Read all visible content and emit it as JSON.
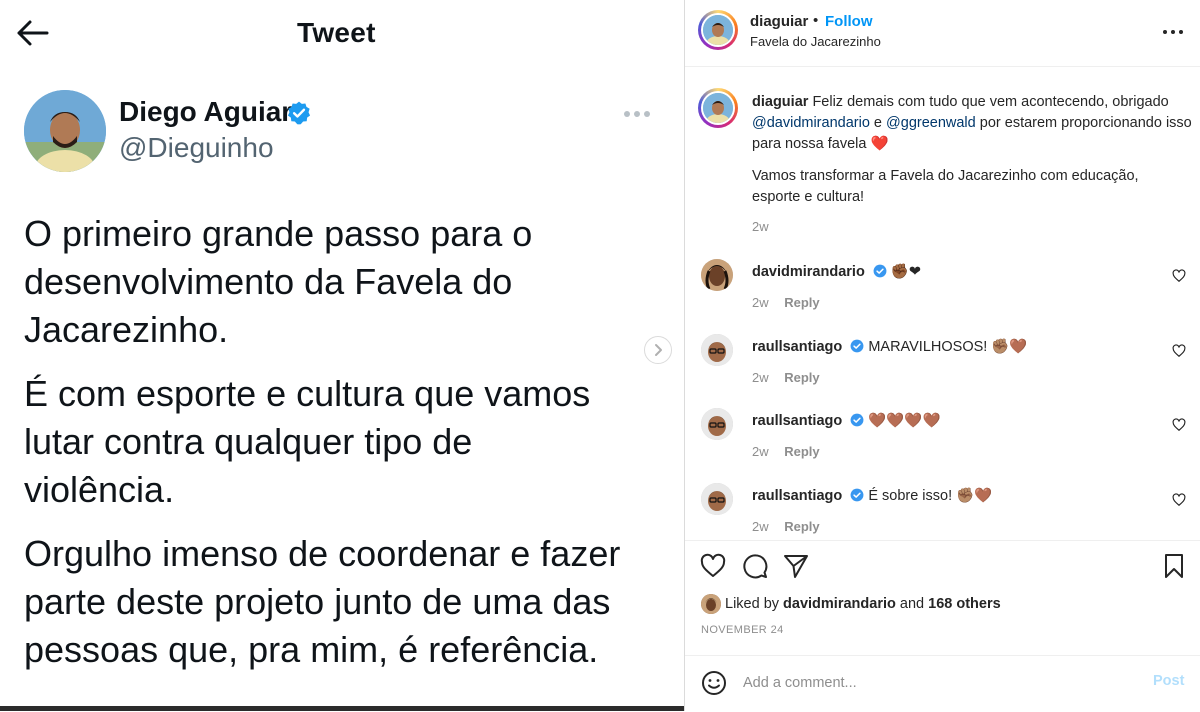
{
  "tweet": {
    "header_title": "Tweet",
    "author_name": "Diego Aguiar",
    "author_handle": "@Dieguinho",
    "paragraphs": [
      "O primeiro grande passo para  o\ndesenvolvimento da Favela do\nJacarezinho.",
      "É com esporte e cultura que vamos\nlutar contra qualquer tipo de\nviolência.",
      "Orgulho imenso de coordenar e fazer\nparte deste projeto junto de uma das\npessoas que, pra mim, é referência."
    ],
    "icons": {
      "back": "arrow-left-icon",
      "verified": "verified-badge-icon",
      "more": "more-horizontal-icon",
      "next": "chevron-right-icon"
    },
    "colors": {
      "verified": "#1d9bf0",
      "text": "#0f1419",
      "secondary": "#536471"
    }
  },
  "instagram": {
    "header": {
      "username": "diaguiar",
      "separator": "•",
      "follow_label": "Follow",
      "location": "Favela do Jacarezinho"
    },
    "caption": {
      "username": "diaguiar",
      "text_before": "Feliz demais com tudo que vem acontecendo, obrigado",
      "mention1": "@davidmirandario",
      "connector": "e",
      "mention2": "@ggreenwald",
      "text_after": "por estarem proporcionando isso para nossa favela ❤️",
      "paragraph2": "Vamos transformar a Favela do Jacarezinho com educação, esporte e cultura!",
      "time": "2w"
    },
    "comments": [
      {
        "username": "davidmirandario",
        "verified": true,
        "text": "✊🏾❤",
        "time": "2w",
        "reply_label": "Reply"
      },
      {
        "username": "raullsantiago",
        "verified": true,
        "text": "MARAVILHOSOS! ✊🏽🤎",
        "time": "2w",
        "reply_label": "Reply"
      },
      {
        "username": "raullsantiago",
        "verified": true,
        "text": "🤎🤎🤎🤎",
        "time": "2w",
        "reply_label": "Reply"
      },
      {
        "username": "raullsantiago",
        "verified": true,
        "text": "É sobre isso! ✊🏽🤎",
        "time": "2w",
        "reply_label": "Reply"
      }
    ],
    "likes": {
      "prefix": "Liked by",
      "user": "davidmirandario",
      "connector": "and",
      "others": "168 others"
    },
    "date": "NOVEMBER 24",
    "comment_box": {
      "placeholder": "Add a comment...",
      "post_label": "Post"
    },
    "icons": {
      "heart": "heart-icon",
      "comment": "comment-icon",
      "share": "share-icon",
      "save": "bookmark-icon",
      "emoji": "emoji-icon",
      "more": "more-horizontal-icon",
      "verified": "verified-badge-icon"
    },
    "colors": {
      "link": "#0095f6",
      "mention": "#00376b",
      "muted": "#8e8e8e",
      "post_disabled": "#b2dffc"
    }
  }
}
